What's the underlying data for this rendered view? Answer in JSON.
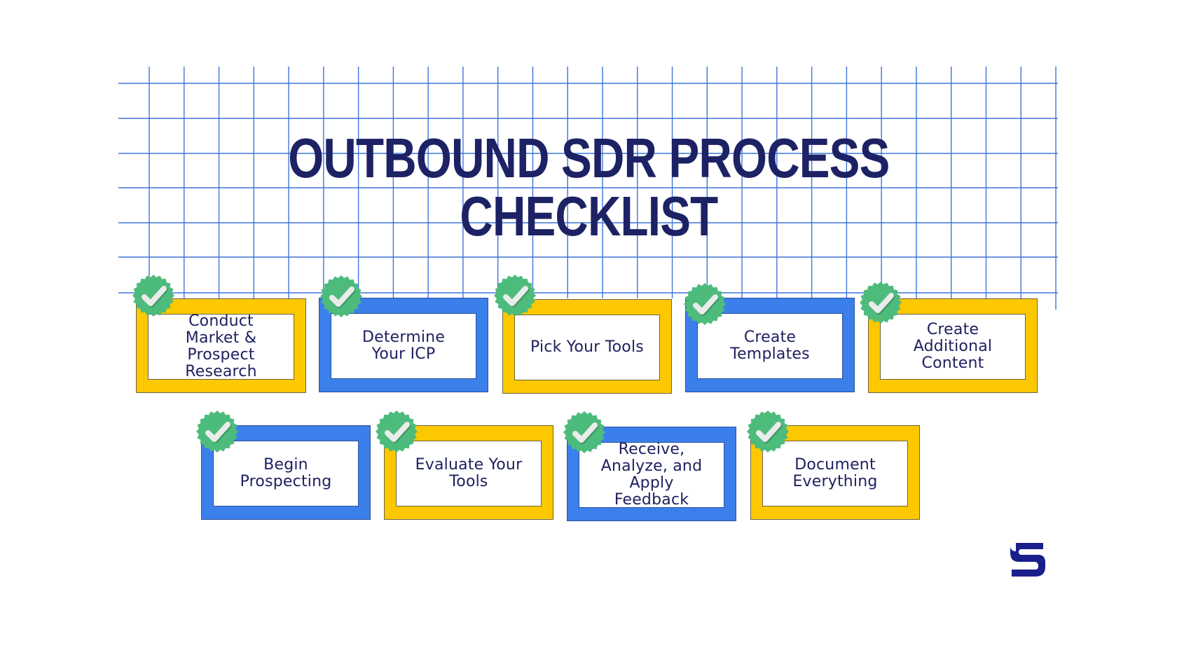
{
  "title": {
    "line1": "OUTBOUND SDR PROCESS",
    "line2": "CHECKLIST"
  },
  "colors": {
    "title": "#1d2265",
    "grid_line": "#3f74da",
    "yellow_frame": "#fdc800",
    "blue_frame": "#3b80ea",
    "badge_green": "#4dbb7b",
    "checkmark": "#e9ecea",
    "label_text": "#1f2160",
    "logo": "#1a1f8c"
  },
  "steps": [
    {
      "label": "Conduct\nMarket &\nProspect\nResearch",
      "frame": "yellow",
      "checked": true
    },
    {
      "label": "Determine\nYour ICP",
      "frame": "blue",
      "checked": true
    },
    {
      "label": "Pick Your Tools",
      "frame": "yellow",
      "checked": true
    },
    {
      "label": "Create\nTemplates",
      "frame": "blue",
      "checked": true
    },
    {
      "label": "Create\nAdditional\nContent",
      "frame": "yellow",
      "checked": true
    },
    {
      "label": "Begin\nProspecting",
      "frame": "blue",
      "checked": true
    },
    {
      "label": "Evaluate Your\nTools",
      "frame": "yellow",
      "checked": true
    },
    {
      "label": "Receive,\nAnalyze, and\nApply\nFeedback",
      "frame": "blue",
      "checked": true
    },
    {
      "label": "Document\nEverything",
      "frame": "yellow",
      "checked": true
    }
  ],
  "icons": {
    "badge": "check-badge-icon",
    "logo": "brand-s-logo"
  }
}
